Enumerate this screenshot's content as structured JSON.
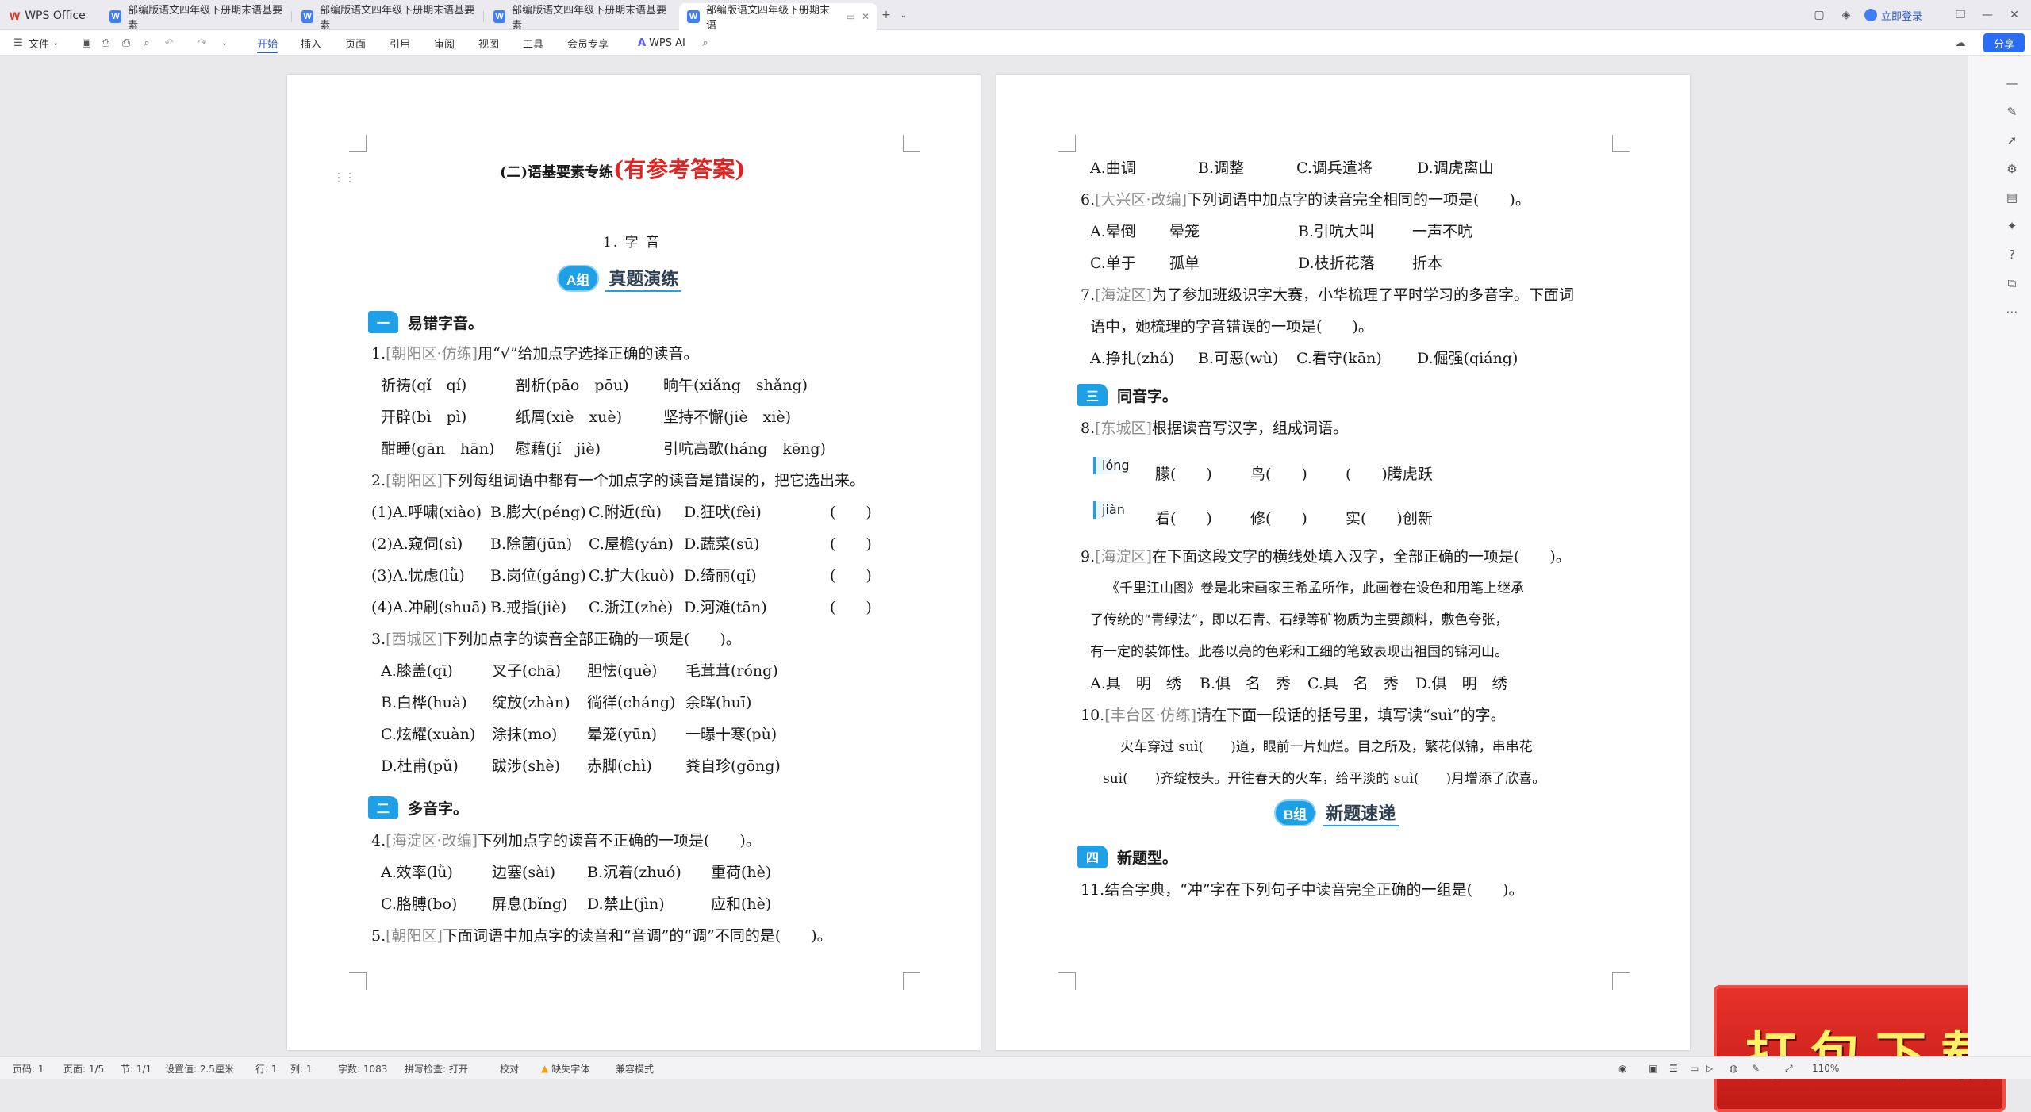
{
  "titlebar": {
    "app_name": "WPS Office",
    "tabs": [
      {
        "label": "部编版语文四年级下册期末语基要素"
      },
      {
        "label": "部编版语文四年级下册期末语基要素"
      },
      {
        "label": "部编版语文四年级下册期末语基要素"
      },
      {
        "label": "部编版语文四年级下册期末语"
      }
    ],
    "login": "立即登录"
  },
  "menubar": {
    "file": "文件",
    "items": [
      "开始",
      "插入",
      "页面",
      "引用",
      "审阅",
      "视图",
      "工具",
      "会员专享"
    ],
    "ai": "WPS AI",
    "share": "分享"
  },
  "page1": {
    "title_main": "(二)语基要素专练",
    "title_red": "(有参考答案)",
    "subtitle": "1. 字 音",
    "banner_a": {
      "badge": "A组",
      "text": "真题演练"
    },
    "sec1": {
      "icon": "一",
      "text": "易错字音。"
    },
    "q1": {
      "num": "1.",
      "src": "[朝阳区·仿练]",
      "text": "用“√”给加点字选择正确的读音。"
    },
    "q1_rows": [
      [
        "祈祷(qǐ　qí)",
        "剖析(pāo　pōu)",
        "晌午(xiǎng　shǎng)"
      ],
      [
        "开辟(bì　pì)",
        "纸屑(xiè　xuè)",
        "坚持不懈(jiè　xiè)"
      ],
      [
        "酣睡(gān　hān)",
        "慰藉(jí　jiè)",
        "引吭高歌(háng　kēng)"
      ]
    ],
    "q2": {
      "num": "2.",
      "src": "[朝阳区]",
      "text": "下列每组词语中都有一个加点字的读音是错误的，把它选出来。"
    },
    "q2_rows": [
      [
        "(1)A.呼啸(xiào)",
        "B.膨大(péng)",
        "C.附近(fù)",
        "D.狂吠(fèi)",
        "(　　)"
      ],
      [
        "(2)A.窥伺(sì)",
        "B.除菌(jūn)",
        "C.屋檐(yán)",
        "D.蔬菜(sū)",
        "(　　)"
      ],
      [
        "(3)A.忧虑(lǜ)",
        "B.岗位(gǎng)",
        "C.扩大(kuò)",
        "D.绮丽(qǐ)",
        "(　　)"
      ],
      [
        "(4)A.冲刷(shuā)",
        "B.戒指(jiè)",
        "C.浙江(zhè)",
        "D.河滩(tān)",
        "(　　)"
      ]
    ],
    "q3": {
      "num": "3.",
      "src": "[西城区]",
      "text": "下列加点字的读音全部正确的一项是(　　)。"
    },
    "q3_rows": [
      [
        "A.膝盖(qī)",
        "叉子(chā)",
        "胆怯(què)",
        "毛茸茸(róng)"
      ],
      [
        "B.白桦(huà)",
        "绽放(zhàn)",
        "徜徉(cháng)",
        "余晖(huī)"
      ],
      [
        "C.炫耀(xuàn)",
        "涂抹(mo)",
        "晕笼(yūn)",
        "一曝十寒(pù)"
      ],
      [
        "D.杜甫(pǔ)",
        "跋涉(shè)",
        "赤脚(chì)",
        "粪自珍(gōng)"
      ]
    ],
    "sec2": {
      "icon": "二",
      "text": "多音字。"
    },
    "q4": {
      "num": "4.",
      "src": "[海淀区·改编]",
      "text": "下列加点字的读音不正确的一项是(　　)。"
    },
    "q4_rows": [
      [
        "A.效率(lǜ)",
        "边塞(sài)",
        "B.沉着(zhuó)",
        "重荷(hè)"
      ],
      [
        "C.胳膊(bo)",
        "屏息(bǐng)",
        "D.禁止(jìn)",
        "应和(hè)"
      ]
    ],
    "q5": {
      "num": "5.",
      "src": "[朝阳区]",
      "text": "下面词语中加点字的读音和“音调”的“调”不同的是(　　)。"
    }
  },
  "page2": {
    "q5_opts": [
      "A.曲调",
      "B.调整",
      "C.调兵遣将",
      "D.调虎离山"
    ],
    "q6": {
      "num": "6.",
      "src": "[大兴区·改编]",
      "text": "下列词语中加点字的读音完全相同的一项是(　　)。"
    },
    "q6_rows": [
      [
        "A.晕倒",
        "晕笼",
        "B.引吭大叫",
        "一声不吭"
      ],
      [
        "C.单于",
        "孤单",
        "D.枝折花落",
        "折本"
      ]
    ],
    "q7": {
      "num": "7.",
      "src": "[海淀区]",
      "text": "为了参加班级识字大赛，小华梳理了平时学习的多音字。下面词"
    },
    "q7_line2": "语中，她梳理的字音错误的一项是(　　)。",
    "q7_opts": [
      "A.挣扎(zhá)",
      "B.可恶(wù)",
      "C.看守(kān)",
      "D.倔强(qiáng)"
    ],
    "sec3": {
      "icon": "三",
      "text": "同音字。"
    },
    "q8": {
      "num": "8.",
      "src": "[东城区]",
      "text": "根据读音写汉字，组成词语。"
    },
    "q8_rows": [
      {
        "pinyin": "lóng",
        "items": [
          "朦(　　)",
          "鸟(　　)",
          "(　　)腾虎跃"
        ]
      },
      {
        "pinyin": "jiàn",
        "items": [
          "看(　　)",
          "修(　　)",
          "实(　　)创新"
        ]
      }
    ],
    "q9": {
      "num": "9.",
      "src": "[海淀区]",
      "text": "在下面这段文字的横线处填入汉字，全部正确的一项是(　　)。"
    },
    "q9_para": [
      "《千里江山图》卷是北宋画家王希孟所作，此画卷在设色和用笔上继承",
      "了传统的“青绿法”，即以石青、石绿等矿物质为主要颜料，敷色夸张，",
      "有一定的装饰性。此卷以亮的色彩和工细的笔致表现出祖国的锦河山。"
    ],
    "q9_opts": [
      "A.具　明　绣",
      "B.俱　名　秀",
      "C.具　名　秀",
      "D.俱　明　绣"
    ],
    "q10": {
      "num": "10.",
      "src": "[丰台区·仿练]",
      "text": "请在下面一段话的括号里，填写读“suì”的字。"
    },
    "q10_para": [
      "火车穿过 suì(　　)道，眼前一片灿烂。目之所及，繁花似锦，串串花",
      "suì(　　)齐绽枝头。开往春天的火车，给平淡的 suì(　　)月增添了欣喜。"
    ],
    "banner_b": {
      "badge": "B组",
      "text": "新题速递"
    },
    "sec4": {
      "icon": "四",
      "text": "新题型。"
    },
    "q11": {
      "num": "11.",
      "text": "结合字典，“冲”字在下列句子中读音完全正确的一组是(　　)。"
    }
  },
  "statusbar": {
    "page_code": "页码: 1",
    "pages": "页面: 1/5",
    "section": "节: 1/1",
    "setting": "设置值: 2.5厘米",
    "row": "行: 1",
    "col": "列: 1",
    "words": "字数: 1083",
    "spell": "拼写检查: 打开",
    "proof": "校对",
    "missing_font": "缺失字体",
    "compat": "兼容模式",
    "zoom": "110%"
  },
  "promo": {
    "text": "打包下载"
  }
}
